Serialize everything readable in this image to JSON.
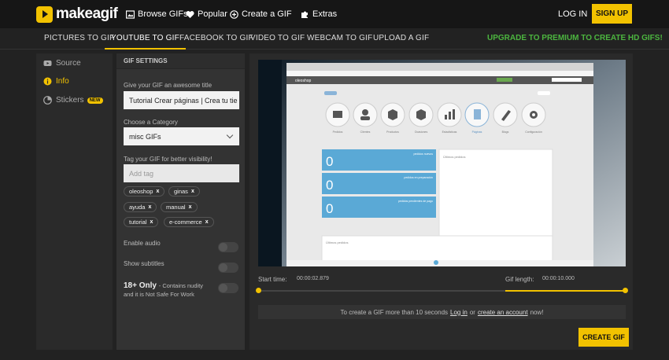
{
  "brand": {
    "name": "makeagif",
    "accent": "#f2c200",
    "green": "#4cb53f"
  },
  "topnav": {
    "browse": "Browse GIFs",
    "popular": "Popular",
    "create": "Create a GIF",
    "extras": "Extras",
    "login": "LOG IN",
    "signup": "SIGN UP"
  },
  "tabs": [
    "PICTURES TO GIF",
    "YOUTUBE TO GIF",
    "FACEBOOK TO GIF",
    "VIDEO TO GIF",
    "WEBCAM TO GIF",
    "UPLOAD A GIF"
  ],
  "upgrade": "UPGRADE TO PREMIUM TO CREATE HD GIFS!",
  "sidebar": {
    "source": "Source",
    "info": "Info",
    "stickers": "Stickers",
    "new_badge": "NEW"
  },
  "settings": {
    "header": "GIF SETTINGS",
    "title_label": "Give your GIF an awesome title",
    "title_value": "Tutorial Crear páginas | Crea tu tie",
    "category_label": "Choose a Category",
    "category_value": "misc GIFs",
    "tag_label": "Tag your GIF for better visibility!",
    "tag_placeholder": "Add tag",
    "tags": [
      "oleoshop",
      "ginas",
      "ayuda",
      "manual",
      "tutorial",
      "e-commerce"
    ],
    "tag_remove": "x",
    "enable_audio": "Enable audio",
    "show_subtitles": "Show subtitles",
    "adult_title": "18+ Only",
    "adult_desc1": "- Contains nudity",
    "adult_desc2": "and it is Not Safe For Work"
  },
  "video_preview": {
    "site_logo": "oleoshop",
    "menu_labels": [
      "Pedidos",
      "Clientes",
      "Productos",
      "Ocasiones",
      "Estadísticas",
      "Páginas",
      "Blogs",
      "Configuración"
    ],
    "stat_values": [
      "0",
      "0",
      "0"
    ],
    "stat_labels": [
      "pedidos nuevos",
      "pedidos en preparación",
      "pedidos pendientes de pago"
    ],
    "panel_latest": "Últimos pedidos",
    "panel_latest2": "Últimos pedidos"
  },
  "timeline": {
    "start_label": "Start time:",
    "start_value": "00:00:02.879",
    "length_label": "Gif length:",
    "length_value": "00:00:10.000",
    "selection_fraction_start": 0.672,
    "selection_fraction_end": 1.0
  },
  "notice": {
    "text_before": "To create a GIF more than 10 seconds",
    "login_link": "Log in",
    "text_mid": "or",
    "account_link": "create an account",
    "text_after": "now!"
  },
  "create_button": "CREATE GIF"
}
